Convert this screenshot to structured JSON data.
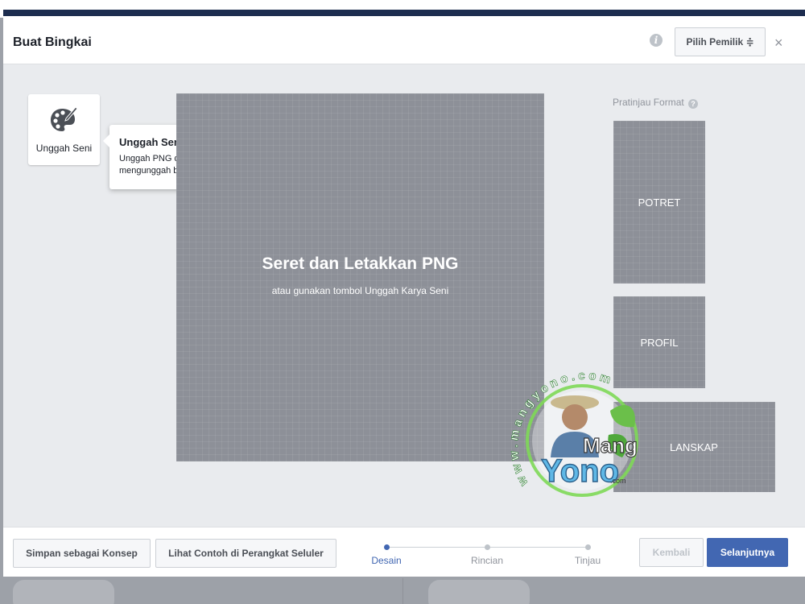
{
  "dialog": {
    "title": "Buat Bingkai",
    "owner_button": "Pilih Pemilik ≑",
    "close_glyph": "×"
  },
  "upload_tile": {
    "label": "Unggah Seni"
  },
  "tooltip": {
    "title": "Unggah Seni",
    "body": "Unggah PNG dengan gambar latar transparan. Anda dapat mengunggah beberapa PNG sekaligus."
  },
  "canvas": {
    "title": "Seret dan Letakkan PNG",
    "subtitle": "atau gunakan tombol Unggah Karya Seni"
  },
  "preview": {
    "label": "Pratinjau Format",
    "formats": [
      "POTRET",
      "PROFIL",
      "LANSKAP"
    ]
  },
  "footer": {
    "draft_button": "Simpan sebagai Konsep",
    "mobile_button": "Lihat Contoh di Perangkat Seluler",
    "back_button": "Kembali",
    "next_button": "Selanjutnya",
    "steps": [
      {
        "label": "Desain",
        "active": true
      },
      {
        "label": "Rincian",
        "active": false
      },
      {
        "label": "Tinjau",
        "active": false
      }
    ]
  },
  "watermark": {
    "ring_text": "www.mangyono.com",
    "line1": "Mang",
    "line2": "Yono",
    "suffix": ".com"
  },
  "colors": {
    "accent": "#4267b2",
    "canvas": "#8d9098",
    "header_strip": "#1d2d4f"
  },
  "icons": [
    "info-icon",
    "palette-icon",
    "close-icon",
    "help-icon"
  ]
}
